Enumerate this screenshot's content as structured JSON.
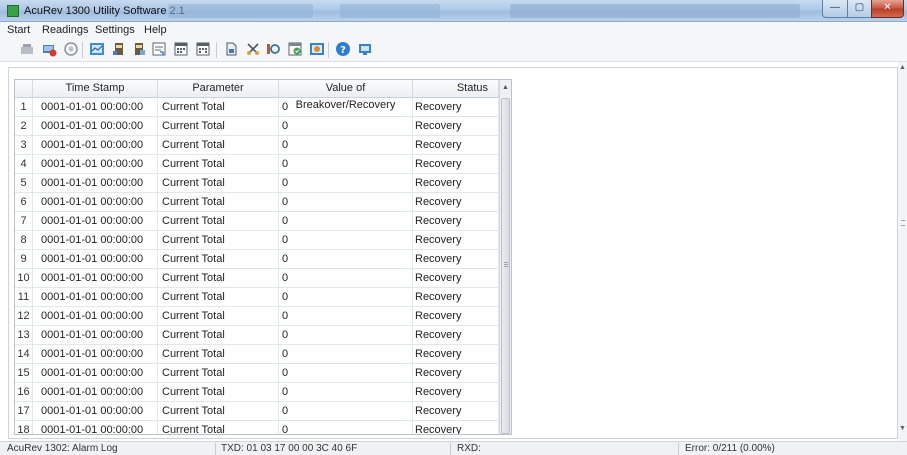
{
  "window": {
    "title": "AcuRev 1300 Utility Software 2.1",
    "controls": {
      "minimize": "—",
      "maximize": "▢",
      "close": "✕"
    }
  },
  "menu": [
    "Start",
    "Readings",
    "Settings",
    "Help"
  ],
  "toolbar": {
    "icons": [
      "disconnect-icon",
      "connect-icon",
      "search-device-icon",
      "realtime-icon",
      "meter-icon",
      "meter-settings-icon",
      "export-icon",
      "calendar-icon",
      "calendar-event-icon",
      "document-icon",
      "tools-icon",
      "io-icon",
      "schedule-icon",
      "settings-window-icon",
      "help-icon",
      "exit-icon"
    ]
  },
  "table": {
    "columns": [
      "Time Stamp",
      "Parameter",
      "Value of Breakover/Recovery",
      "Status"
    ],
    "rows": [
      {
        "num": "1",
        "timestamp": "0001-01-01 00:00:00",
        "parameter": "Current Total",
        "value": "0",
        "status": "Recovery"
      },
      {
        "num": "2",
        "timestamp": "0001-01-01 00:00:00",
        "parameter": "Current Total",
        "value": "0",
        "status": "Recovery"
      },
      {
        "num": "3",
        "timestamp": "0001-01-01 00:00:00",
        "parameter": "Current Total",
        "value": "0",
        "status": "Recovery"
      },
      {
        "num": "4",
        "timestamp": "0001-01-01 00:00:00",
        "parameter": "Current Total",
        "value": "0",
        "status": "Recovery"
      },
      {
        "num": "5",
        "timestamp": "0001-01-01 00:00:00",
        "parameter": "Current Total",
        "value": "0",
        "status": "Recovery"
      },
      {
        "num": "6",
        "timestamp": "0001-01-01 00:00:00",
        "parameter": "Current Total",
        "value": "0",
        "status": "Recovery"
      },
      {
        "num": "7",
        "timestamp": "0001-01-01 00:00:00",
        "parameter": "Current Total",
        "value": "0",
        "status": "Recovery"
      },
      {
        "num": "8",
        "timestamp": "0001-01-01 00:00:00",
        "parameter": "Current Total",
        "value": "0",
        "status": "Recovery"
      },
      {
        "num": "9",
        "timestamp": "0001-01-01 00:00:00",
        "parameter": "Current Total",
        "value": "0",
        "status": "Recovery"
      },
      {
        "num": "10",
        "timestamp": "0001-01-01 00:00:00",
        "parameter": "Current Total",
        "value": "0",
        "status": "Recovery"
      },
      {
        "num": "11",
        "timestamp": "0001-01-01 00:00:00",
        "parameter": "Current Total",
        "value": "0",
        "status": "Recovery"
      },
      {
        "num": "12",
        "timestamp": "0001-01-01 00:00:00",
        "parameter": "Current Total",
        "value": "0",
        "status": "Recovery"
      },
      {
        "num": "13",
        "timestamp": "0001-01-01 00:00:00",
        "parameter": "Current Total",
        "value": "0",
        "status": "Recovery"
      },
      {
        "num": "14",
        "timestamp": "0001-01-01 00:00:00",
        "parameter": "Current Total",
        "value": "0",
        "status": "Recovery"
      },
      {
        "num": "15",
        "timestamp": "0001-01-01 00:00:00",
        "parameter": "Current Total",
        "value": "0",
        "status": "Recovery"
      },
      {
        "num": "16",
        "timestamp": "0001-01-01 00:00:00",
        "parameter": "Current Total",
        "value": "0",
        "status": "Recovery"
      },
      {
        "num": "17",
        "timestamp": "0001-01-01 00:00:00",
        "parameter": "Current Total",
        "value": "0",
        "status": "Recovery"
      },
      {
        "num": "18",
        "timestamp": "0001-01-01 00:00:00",
        "parameter": "Current Total",
        "value": "0",
        "status": "Recovery"
      }
    ]
  },
  "statusbar": {
    "device": "AcuRev 1302: Alarm Log",
    "txd": "TXD:  01 03 17 00 00 3C 40 6F",
    "rxd": "RXD:",
    "error": "Error:  0/211  (0.00%)"
  },
  "colors": {
    "titlebar": "#afc9e6",
    "close_button": "#c7503c",
    "header_bg": "#eceff3",
    "grid_line": "#e3e6ea"
  }
}
